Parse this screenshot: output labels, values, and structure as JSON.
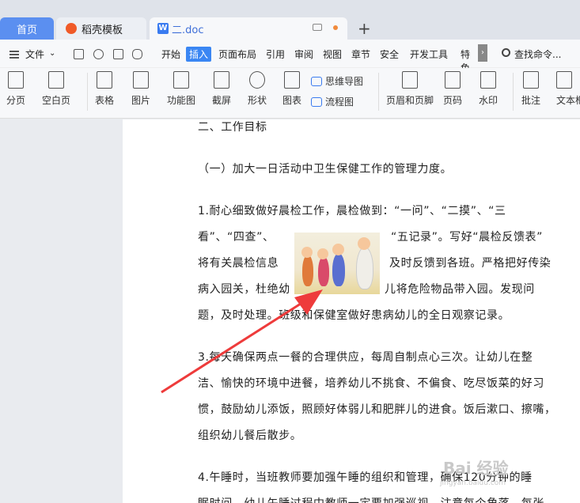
{
  "tabs": {
    "home": "首页",
    "template": "稻壳模板",
    "doc": "二.doc"
  },
  "menu": {
    "file": "文件",
    "items": [
      "开始",
      "插入",
      "页面布局",
      "引用",
      "审阅",
      "视图",
      "章节",
      "安全",
      "开发工具",
      "特色"
    ],
    "active": "插入",
    "search": "查找命令..."
  },
  "ribbon": {
    "page_break": "分页",
    "blank_page": "空白页",
    "table": "表格",
    "picture": "图片",
    "function_chart": "功能图",
    "screenshot": "截屏",
    "shape": "形状",
    "chart": "图表",
    "mindmap": "思维导图",
    "flowchart": "流程图",
    "header_footer": "页眉和页脚",
    "page_number": "页码",
    "watermark": "水印",
    "comment": "批注",
    "textbox": "文本框"
  },
  "document": {
    "lines": [
      "二、工作目标",
      "（一）加大一日活动中卫生保健工作的管理力度。",
      "1.耐心细致做好晨检工作，晨检做到：“一问”、“二摸”、“三",
      "看”、“四查”、",
      "“五记录”。写好“晨检反馈表”",
      "将有关晨检信息",
      "及时反馈到各班。严格把好传染",
      "病入园关，杜绝幼",
      "儿将危险物品带入园。发现问",
      "题，及时处理。班级和保健室做好患病幼儿的全日观察记录。",
      "3.每天确保两点一餐的合理供应，每周自制点心三次。让幼儿在整",
      "洁、愉快的环境中进餐，培养幼儿不挑食、不偏食、吃尽饭菜的好习",
      "惯，鼓励幼儿添饭，照顾好体弱儿和肥胖儿的进食。饭后漱口、擦嘴，",
      "组织幼儿餐后散步。",
      "4.午睡时，当班教师要加强午睡的组织和管理，确保120分钟的睡",
      "眠时间。幼儿午睡过程中教师一定要加强巡视，注意每个角落，每张"
    ]
  },
  "watermark": {
    "text": "Bai 经验",
    "sub": "jingyan.baidu.com"
  },
  "colors": {
    "accent": "#3a86f3",
    "home_tab": "#5b8ff0",
    "arrow": "#ee3b3b"
  }
}
